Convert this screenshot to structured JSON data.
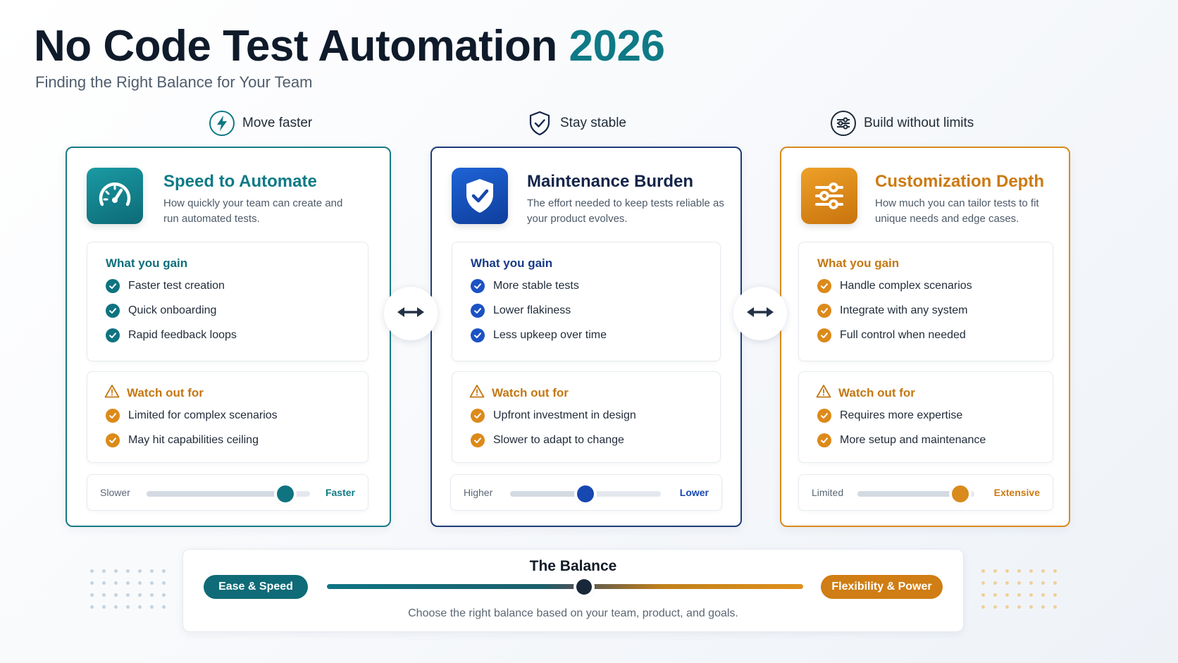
{
  "header": {
    "title": "No Code Test Automation",
    "year": "2026",
    "subtitle": "Finding the Right Balance for Your Team"
  },
  "columns": [
    {
      "heading": "Move faster",
      "heading_icon": "lightning-icon",
      "title": "Speed to Automate",
      "description": "How quickly your team can create and run automated tests.",
      "icon": "speedometer-icon",
      "accent": "#0e7a86",
      "gain_title": "What you gain",
      "gains": [
        "Faster test creation",
        "Quick onboarding",
        "Rapid feedback loops"
      ],
      "watch_title": "Watch out for",
      "watch": [
        "Limited for complex scenarios",
        "May hit capabilities ceiling"
      ],
      "slider": {
        "left": "Slower",
        "right": "Faster",
        "value": 0.85
      }
    },
    {
      "heading": "Stay stable",
      "heading_icon": "shield-check-icon",
      "title": "Maintenance Burden",
      "description": "The effort needed to keep tests reliable as your product evolves.",
      "icon": "shield-check-icon",
      "accent": "#1b52c4",
      "gain_title": "What you gain",
      "gains": [
        "More stable tests",
        "Lower flakiness",
        "Less upkeep over time"
      ],
      "watch_title": "Watch out for",
      "watch": [
        "Upfront investment in design",
        "Slower to adapt to change"
      ],
      "slider": {
        "left": "Higher",
        "right": "Lower",
        "value": 0.5
      }
    },
    {
      "heading": "Build without limits",
      "heading_icon": "sliders-icon",
      "title": "Customization Depth",
      "description": "How much you can tailor tests to fit unique needs and edge cases.",
      "icon": "sliders-icon",
      "accent": "#dc8a1a",
      "gain_title": "What you gain",
      "gains": [
        "Handle complex scenarios",
        "Integrate with any system",
        "Full control when needed"
      ],
      "watch_title": "Watch out for",
      "watch": [
        "Requires more expertise",
        "More setup and maintenance"
      ],
      "slider": {
        "left": "Limited",
        "right": "Extensive",
        "value": 0.88
      }
    }
  ],
  "balance": {
    "title": "The Balance",
    "left": "Ease & Speed",
    "right": "Flexibility & Power",
    "caption": "Choose the right balance based on your team, product, and goals.",
    "value": 0.54
  }
}
